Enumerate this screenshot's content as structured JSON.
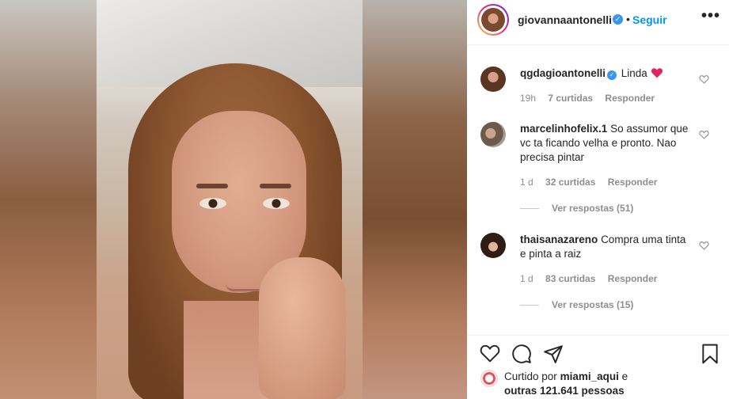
{
  "post": {
    "author": "giovannaantonelli",
    "follow_label": "Seguir",
    "more_label": "•••",
    "separator": "•"
  },
  "comments": [
    {
      "user": "qgdagioantonelli",
      "verified": true,
      "text": "Linda",
      "emoji": "❤️",
      "time": "19h",
      "likes": "7 curtidas",
      "reply": "Responder"
    },
    {
      "user": "marcelinhofelix.1",
      "verified": false,
      "text": "So assumor que vc ta ficando velha e pronto. Nao precisa pintar",
      "time": "1 d",
      "likes": "32 curtidas",
      "reply": "Responder",
      "view_replies": "Ver respostas (51)"
    },
    {
      "user": "thaisanazareno",
      "verified": false,
      "text": "Compra uma tinta e pinta a raiz",
      "time": "1 d",
      "likes": "83 curtidas",
      "reply": "Responder",
      "view_replies": "Ver respostas (15)"
    }
  ],
  "likes_summary": {
    "prefix": "Curtido por",
    "user": "miami_aqui",
    "conj": "e",
    "others": "outras 121.641 pessoas"
  },
  "icons": {
    "like": "heart-outline",
    "comment": "speech-bubble",
    "share": "paper-plane",
    "save": "bookmark",
    "verified": "check-badge"
  },
  "colors": {
    "accent": "#0095f6",
    "verified": "#3897f0",
    "heart": "#ed4956",
    "muted": "#8e8e8e"
  }
}
